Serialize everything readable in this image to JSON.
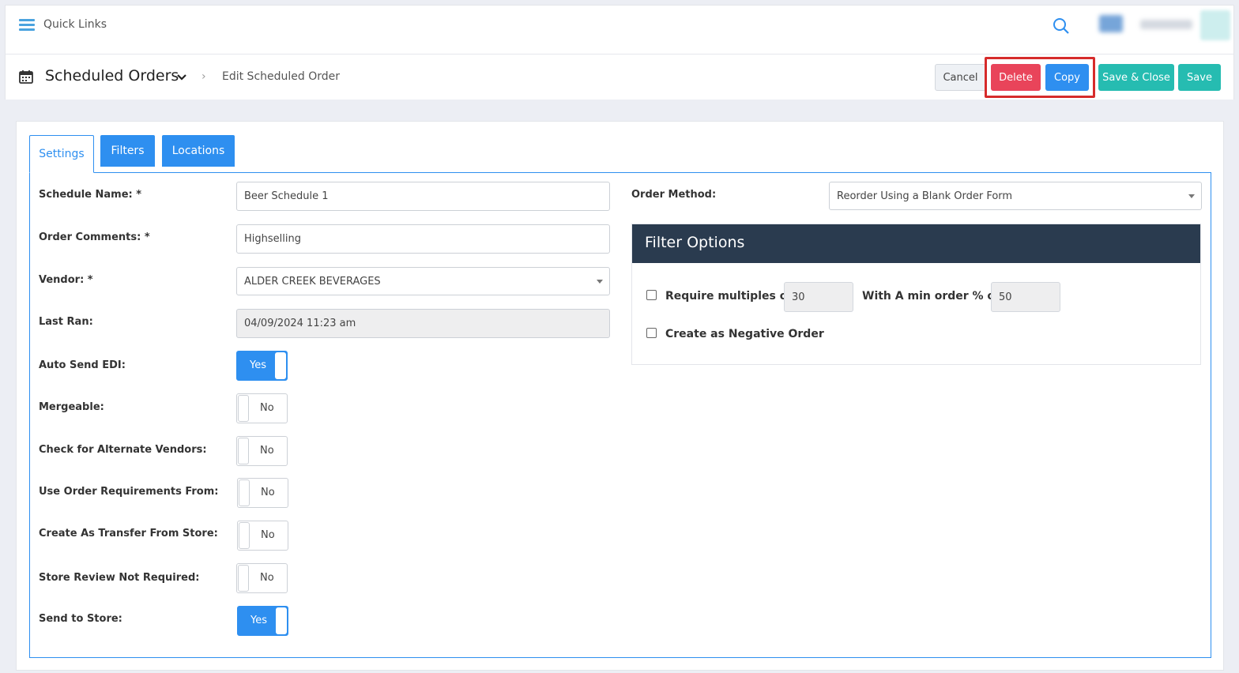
{
  "topbar": {
    "quick_links": "Quick Links"
  },
  "header": {
    "title": "Scheduled Orders",
    "breadcrumb_separator": "›",
    "breadcrumb_current": "Edit Scheduled Order",
    "buttons": {
      "cancel": "Cancel",
      "delete": "Delete",
      "copy": "Copy",
      "save_close": "Save & Close",
      "save": "Save"
    }
  },
  "tabs": [
    "Settings",
    "Filters",
    "Locations"
  ],
  "form": {
    "schedule_name": {
      "label": "Schedule Name: *",
      "value": "Beer Schedule 1"
    },
    "order_comments": {
      "label": "Order Comments: *",
      "value": "Highselling"
    },
    "vendor": {
      "label": "Vendor: *",
      "value": "ALDER CREEK BEVERAGES"
    },
    "last_ran": {
      "label": "Last Ran:",
      "value": "04/09/2024 11:23 am"
    },
    "auto_send_edi": {
      "label": "Auto Send EDI:",
      "value": "Yes"
    },
    "mergeable": {
      "label": "Mergeable:",
      "value": "No"
    },
    "check_alt_vendors": {
      "label": "Check for Alternate Vendors:",
      "value": "No"
    },
    "use_order_requirements": {
      "label": "Use Order Requirements From:",
      "value": "No"
    },
    "create_transfer": {
      "label": "Create As Transfer From Store:",
      "value": "No"
    },
    "store_review": {
      "label": "Store Review Not Required:",
      "value": "No"
    },
    "send_to_store": {
      "label": "Send to Store:",
      "value": "Yes"
    },
    "order_method": {
      "label": "Order Method:",
      "value": "Reorder Using a Blank Order Form"
    }
  },
  "filter_options": {
    "title": "Filter Options",
    "require_multiples_label": "Require multiples of",
    "require_multiples_value": "30",
    "min_order_label": "With A min order % of",
    "min_order_value": "50",
    "negative_order_label": "Create as Negative Order"
  },
  "colors": {
    "primary": "#2e8ff0",
    "danger": "#e9445a",
    "teal": "#26bcb1",
    "dark_header": "#2a3b4f",
    "highlight": "#d62b2b"
  }
}
